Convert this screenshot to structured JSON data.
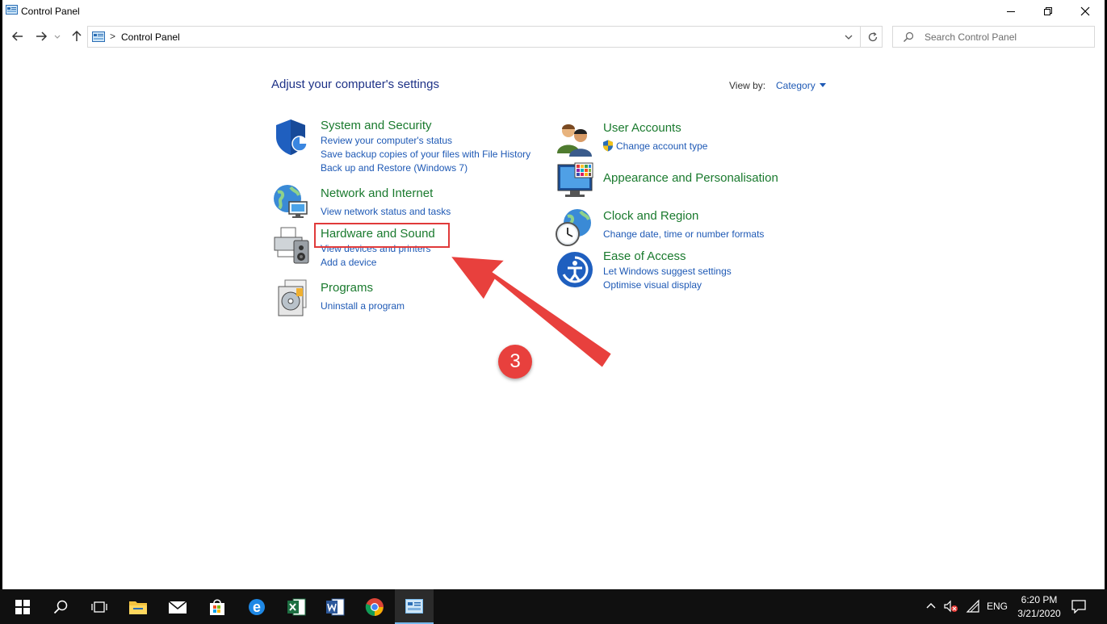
{
  "window": {
    "title": "Control Panel",
    "controls": {
      "minimize": "minimize",
      "restore": "restore",
      "close": "close"
    }
  },
  "address_bar": {
    "separator": ">",
    "breadcrumb": "Control Panel"
  },
  "search": {
    "placeholder": "Search Control Panel"
  },
  "main": {
    "heading": "Adjust your computer's settings",
    "view_by_label": "View by:",
    "view_by_value": "Category"
  },
  "categories_left": [
    {
      "title": "System and Security",
      "icon": "shield-icon",
      "links": [
        "Review your computer's status",
        "Save backup copies of your files with File History",
        "Back up and Restore (Windows 7)"
      ]
    },
    {
      "title": "Network and Internet",
      "icon": "network-globe-icon",
      "links": [
        "View network status and tasks"
      ]
    },
    {
      "title": "Hardware and Sound",
      "icon": "printer-speaker-icon",
      "links": [
        "View devices and printers",
        "Add a device"
      ]
    },
    {
      "title": "Programs",
      "icon": "programs-disc-icon",
      "links": [
        "Uninstall a program"
      ]
    }
  ],
  "categories_right": [
    {
      "title": "User Accounts",
      "icon": "users-icon",
      "links": [
        "Change account type"
      ]
    },
    {
      "title": "Appearance and Personalisation",
      "icon": "monitor-palette-icon",
      "links": []
    },
    {
      "title": "Clock and Region",
      "icon": "clock-globe-icon",
      "links": [
        "Change date, time or number formats"
      ]
    },
    {
      "title": "Ease of Access",
      "icon": "ease-of-access-icon",
      "links": [
        "Let Windows suggest settings",
        "Optimise visual display"
      ]
    }
  ],
  "annotation": {
    "step_number": "3",
    "color": "#e8403d"
  },
  "taskbar": {
    "items": [
      "start-icon",
      "search-icon",
      "task-view-icon",
      "file-explorer-icon",
      "mail-icon",
      "store-icon",
      "edge-icon",
      "excel-icon",
      "word-icon",
      "chrome-icon",
      "control-panel-icon"
    ],
    "language": "ENG",
    "time": "6:20 PM",
    "date": "3/21/2020"
  },
  "colors": {
    "category_title": "#1a7a2e",
    "link": "#1e59b5",
    "heading": "#1e3287",
    "taskbar": "#101010"
  }
}
